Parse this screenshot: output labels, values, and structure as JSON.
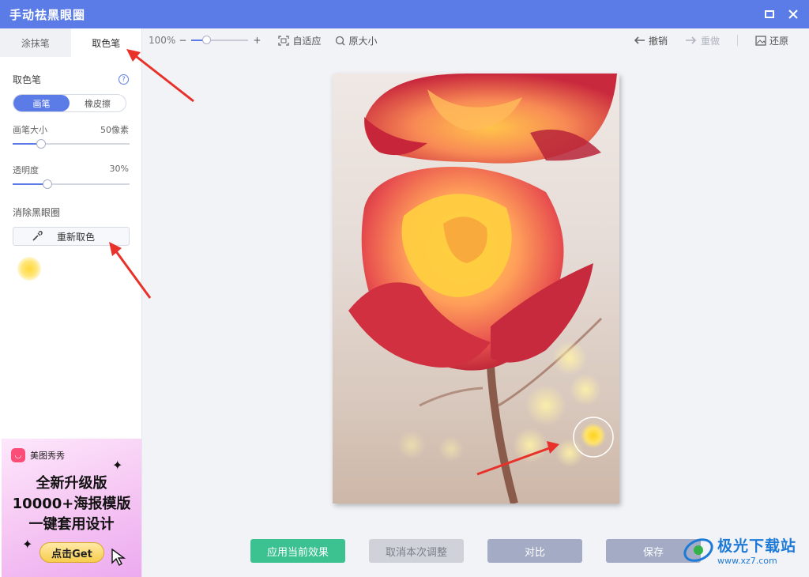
{
  "window": {
    "title": "手动祛黑眼圈"
  },
  "tabs": [
    {
      "label": "涂抹笔",
      "active": false
    },
    {
      "label": "取色笔",
      "active": true
    }
  ],
  "panel": {
    "heading": "取色笔",
    "help_glyph": "?",
    "mode": {
      "brush": "画笔",
      "eraser": "橡皮擦",
      "selected": "画笔"
    },
    "brush_size": {
      "label": "画笔大小",
      "value_text": "50像素",
      "fraction": 0.24
    },
    "opacity": {
      "label": "透明度",
      "value_text": "30%",
      "fraction": 0.3
    },
    "remove_label": "消除黑眼圈",
    "recolor_button": "重新取色",
    "picked_color": "#ffd93a"
  },
  "ad": {
    "brand": "美图秀秀",
    "line1": "全新升级版",
    "line2": "10000+海报模版",
    "line3": "一键套用设计",
    "cta": "点击Get"
  },
  "toolbar": {
    "zoom": "100%",
    "zoom_fraction": 0.2,
    "minus": "−",
    "plus": "+",
    "fit": "自适应",
    "original": "原大小",
    "undo": "撤销",
    "redo": "重做",
    "restore": "还原"
  },
  "buttons": {
    "apply": "应用当前效果",
    "cancel": "取消本次调整",
    "compare": "对比",
    "save": "保存"
  },
  "watermark": {
    "name": "极光下载站",
    "url": "www.xz7.com"
  },
  "colors": {
    "accent": "#5b7be6",
    "apply": "#3cc290",
    "annotation": "#e8312a"
  }
}
